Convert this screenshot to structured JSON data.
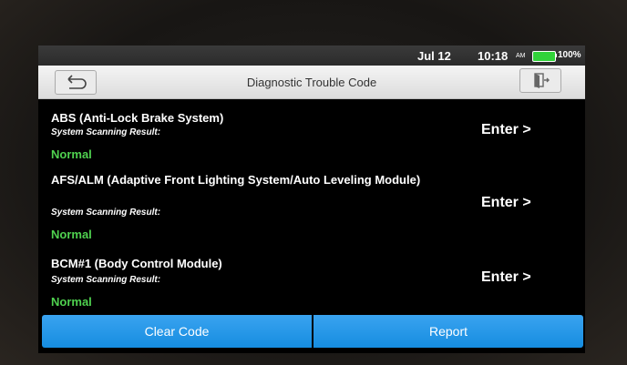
{
  "status": {
    "date": "Jul 12",
    "time": "10:18",
    "ampm": "AM",
    "battery": "100%"
  },
  "header": {
    "title": "Diagnostic Trouble Code"
  },
  "result_label": "System Scanning Result:",
  "items": [
    {
      "name": "ABS (Anti-Lock Brake System)",
      "status": "Normal",
      "action": "Enter >"
    },
    {
      "name": "AFS/ALM (Adaptive Front Lighting System/Auto Leveling Module)",
      "status": "Normal",
      "action": "Enter >"
    },
    {
      "name": "BCM#1 (Body Control Module)",
      "status": "Normal",
      "action": "Enter >"
    }
  ],
  "footer": {
    "clear_label": "Clear Code",
    "report_label": "Report"
  },
  "colors": {
    "accent": "#1e96e8",
    "normal": "#4fd14f",
    "battery": "#31d33a"
  },
  "icons": {
    "back": "back-arrow-icon",
    "exit": "exit-door-icon",
    "battery": "battery-icon"
  }
}
